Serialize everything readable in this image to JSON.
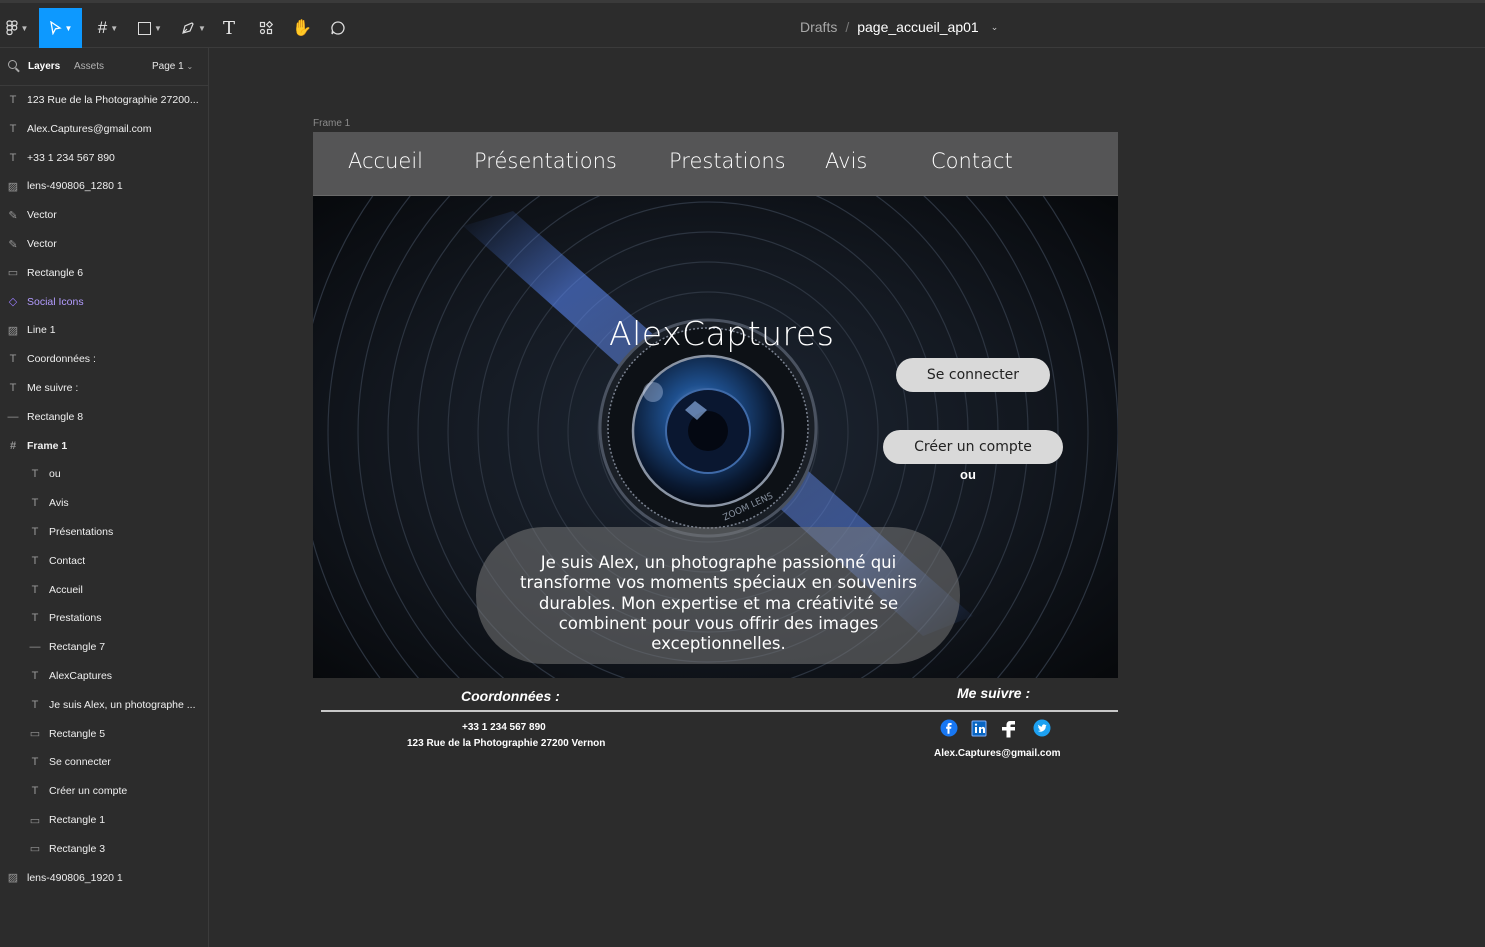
{
  "toolbar": {
    "tools": [
      {
        "name": "main-menu"
      },
      {
        "name": "move-tool"
      },
      {
        "name": "frame-tool"
      },
      {
        "name": "shape-tool"
      },
      {
        "name": "pen-tool"
      },
      {
        "name": "text-tool"
      },
      {
        "name": "resources-tool"
      },
      {
        "name": "hand-tool"
      },
      {
        "name": "comment-tool"
      }
    ],
    "breadcrumb": {
      "folder": "Drafts",
      "separator": "/",
      "file": "page_accueil_ap01"
    }
  },
  "sidebar": {
    "tabs": {
      "layers": "Layers",
      "assets": "Assets"
    },
    "page": "Page 1",
    "layers": [
      {
        "icon": "text",
        "label": "123 Rue de la Photographie 27200..."
      },
      {
        "icon": "text",
        "label": "Alex.Captures@gmail.com"
      },
      {
        "icon": "text",
        "label": "+33 1 234 567 890"
      },
      {
        "icon": "image",
        "label": "lens-490806_1280 1"
      },
      {
        "icon": "vector",
        "label": "Vector"
      },
      {
        "icon": "vector",
        "label": "Vector"
      },
      {
        "icon": "rectangle",
        "label": "Rectangle 6"
      },
      {
        "icon": "component",
        "label": "Social Icons"
      },
      {
        "icon": "image",
        "label": "Line 1"
      },
      {
        "icon": "text",
        "label": "Coordonnées :"
      },
      {
        "icon": "text",
        "label": "Me suivre :"
      },
      {
        "icon": "line",
        "label": "Rectangle 8"
      },
      {
        "icon": "frame",
        "label": "Frame 1"
      },
      {
        "icon": "text",
        "label": "ou"
      },
      {
        "icon": "text",
        "label": "Avis"
      },
      {
        "icon": "text",
        "label": "Présentations"
      },
      {
        "icon": "text",
        "label": "Contact"
      },
      {
        "icon": "text",
        "label": "Accueil"
      },
      {
        "icon": "text",
        "label": "Prestations"
      },
      {
        "icon": "line",
        "label": "Rectangle 7"
      },
      {
        "icon": "text",
        "label": "AlexCaptures"
      },
      {
        "icon": "text",
        "label": "Je suis Alex, un photographe ..."
      },
      {
        "icon": "rectangle",
        "label": "Rectangle 5"
      },
      {
        "icon": "text",
        "label": "Se connecter"
      },
      {
        "icon": "text",
        "label": "Créer un compte"
      },
      {
        "icon": "rectangle",
        "label": "Rectangle 1"
      },
      {
        "icon": "rectangle",
        "label": "Rectangle 3"
      },
      {
        "icon": "image",
        "label": "lens-490806_1920 1"
      }
    ]
  },
  "canvas": {
    "frame_label": "Frame 1",
    "nav": [
      "Accueil",
      "Présentations",
      "Prestations",
      "Avis",
      "Contact"
    ],
    "brand": "AlexCaptures",
    "login": "Se connecter",
    "or": "ou",
    "signup": "Créer un compte",
    "lens_engraving": "ZOOM LENS",
    "bio": "Je suis Alex, un photographe passionné qui transforme vos moments spéciaux en souvenirs durables. Mon expertise et ma créativité se combinent pour vous offrir des images exceptionnelles.",
    "footer": {
      "coordinates_title": "Coordonnées :",
      "follow_title": "Me suivre :",
      "phone": "+33 1 234 567 890",
      "address": "123 Rue de la Photographie 27200 Vernon",
      "email": "Alex.Captures@gmail.com",
      "socials": [
        "facebook",
        "linkedin",
        "facebook-f",
        "twitter"
      ]
    }
  },
  "colors": {
    "accent": "#0d99ff",
    "component": "#9b7dff",
    "button": "#d9d9d9",
    "nav": "#555556"
  }
}
